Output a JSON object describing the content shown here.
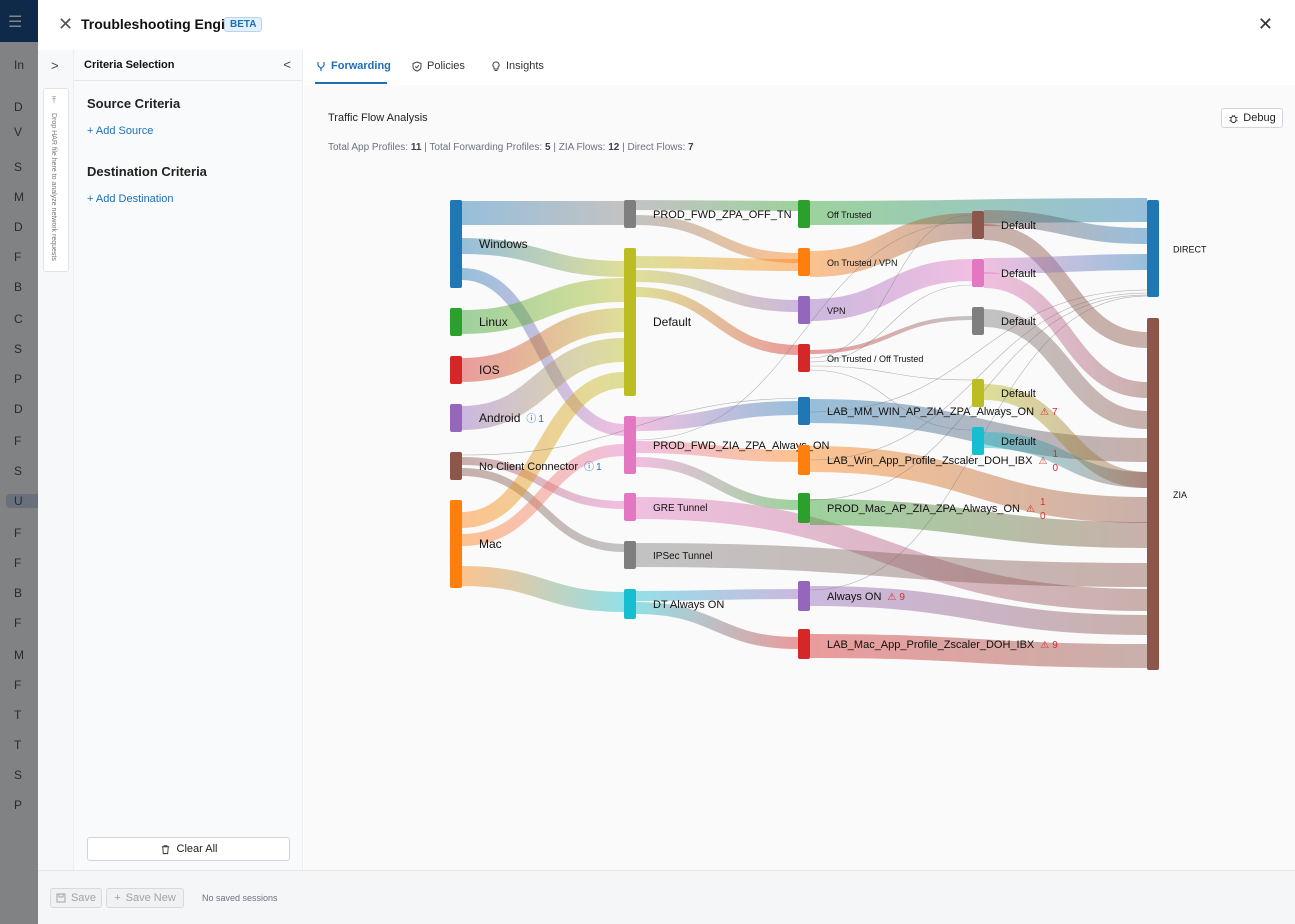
{
  "background": {
    "rail_items": [
      "In",
      "D",
      "V",
      "S",
      "M",
      "D",
      "F",
      "B",
      "C",
      "S",
      "P",
      "D",
      "F",
      "S",
      "U",
      "F",
      "F",
      "B",
      "F",
      "M",
      "F",
      "T",
      "T",
      "S",
      "P"
    ]
  },
  "header": {
    "title": "Troubleshooting Engine",
    "badge": "BETA"
  },
  "sidebar": {
    "drop_hint": "Drop HAR file here to analyze network requests"
  },
  "criteria": {
    "title": "Criteria Selection",
    "source_title": "Source Criteria",
    "add_source": "+ Add Source",
    "destination_title": "Destination Criteria",
    "add_destination": "+ Add Destination",
    "clear_all": "Clear All"
  },
  "tabs": [
    {
      "label": "Forwarding",
      "active": true
    },
    {
      "label": "Policies",
      "active": false
    },
    {
      "label": "Insights",
      "active": false
    }
  ],
  "analysis": {
    "title": "Traffic Flow Analysis",
    "stats": [
      {
        "label": "Total App Profiles: ",
        "value": "11"
      },
      {
        "label": "Total Forwarding Profiles: ",
        "value": "5"
      },
      {
        "label": "ZIA Flows: ",
        "value": "12"
      },
      {
        "label": "Direct Flows: ",
        "value": "7"
      }
    ],
    "debug_label": "Debug"
  },
  "sankey": {
    "nodes": [
      {
        "label": "Windows",
        "color": "#1f77b4",
        "badge": ""
      },
      {
        "label": "Linux",
        "color": "#2ca02c",
        "badge": ""
      },
      {
        "label": "IOS",
        "color": "#d62728",
        "badge": ""
      },
      {
        "label": "Android",
        "color": "#9467bd",
        "badge": "1",
        "badge_type": "info"
      },
      {
        "label": "No Client Connector",
        "color": "#8c564b",
        "badge": "1",
        "badge_type": "info"
      },
      {
        "label": "Mac",
        "color": "#ff7f0e",
        "badge": ""
      },
      {
        "label": "PROD_FWD_ZPA_OFF_TN",
        "color": "#7f7f7f",
        "badge": ""
      },
      {
        "label": "Default",
        "color": "#bcbd22",
        "badge": ""
      },
      {
        "label": "PROD_FWD_ZIA_ZPA_Always_ON",
        "color": "#e377c2",
        "badge": ""
      },
      {
        "label": "GRE Tunnel",
        "color": "#e377c2",
        "badge": ""
      },
      {
        "label": "IPSec Tunnel",
        "color": "#7f7f7f",
        "badge": ""
      },
      {
        "label": "DT Always ON",
        "color": "#17becf",
        "badge": ""
      },
      {
        "label": "Off Trusted",
        "color": "#2ca02c",
        "badge": ""
      },
      {
        "label": "On Trusted / VPN",
        "color": "#ff7f0e",
        "badge": ""
      },
      {
        "label": "VPN",
        "color": "#9467bd",
        "badge": ""
      },
      {
        "label": "On Trusted / Off Trusted",
        "color": "#d62728",
        "badge": ""
      },
      {
        "label": "LAB_MM_WIN_AP_ZIA_ZPA_Always_ON",
        "color": "#1f77b4",
        "badge": "7",
        "badge_type": "warn"
      },
      {
        "label": "LAB_Win_App_Profile_Zscaler_DOH_IBX",
        "color": "#ff7f0e",
        "badge": "10",
        "badge_type": "warn"
      },
      {
        "label": "PROD_Mac_AP_ZIA_ZPA_Always_ON",
        "color": "#2ca02c",
        "badge": "10",
        "badge_type": "warn"
      },
      {
        "label": "Always ON",
        "color": "#9467bd",
        "badge": "9",
        "badge_type": "warn"
      },
      {
        "label": "LAB_Mac_App_Profile_Zscaler_DOH_IBX",
        "color": "#d62728",
        "badge": "9",
        "badge_type": "warn"
      },
      {
        "label": "Default",
        "color": "#8c564b",
        "badge": ""
      },
      {
        "label": "Default",
        "color": "#e377c2",
        "badge": ""
      },
      {
        "label": "Default",
        "color": "#7f7f7f",
        "badge": ""
      },
      {
        "label": "Default",
        "color": "#bcbd22",
        "badge": ""
      },
      {
        "label": "Default",
        "color": "#17becf",
        "badge": ""
      },
      {
        "label": "DIRECT",
        "color": "#1f77b4",
        "badge": ""
      },
      {
        "label": "ZIA",
        "color": "#8c564b",
        "badge": ""
      }
    ],
    "links": [
      {
        "source": "Windows",
        "target": "PROD_FWD_ZPA_OFF_TN"
      },
      {
        "source": "Windows",
        "target": "Default"
      },
      {
        "source": "Windows",
        "target": "PROD_FWD_ZIA_ZPA_Always_ON"
      },
      {
        "source": "Linux",
        "target": "Default"
      },
      {
        "source": "IOS",
        "target": "Default"
      },
      {
        "source": "Android",
        "target": "Default"
      },
      {
        "source": "No Client Connector",
        "target": "GRE Tunnel"
      },
      {
        "source": "No Client Connector",
        "target": "IPSec Tunnel"
      },
      {
        "source": "Mac",
        "target": "Default"
      },
      {
        "source": "Mac",
        "target": "PROD_FWD_ZIA_ZPA_Always_ON"
      },
      {
        "source": "Mac",
        "target": "DT Always ON"
      },
      {
        "source": "PROD_FWD_ZPA_OFF_TN",
        "target": "Off Trusted"
      },
      {
        "source": "PROD_FWD_ZPA_OFF_TN",
        "target": "On Trusted / VPN"
      },
      {
        "source": "Default",
        "target": "On Trusted / VPN"
      },
      {
        "source": "Default",
        "target": "VPN"
      },
      {
        "source": "Default",
        "target": "On Trusted / Off Trusted"
      },
      {
        "source": "PROD_FWD_ZIA_ZPA_Always_ON",
        "target": "LAB_MM_WIN_AP_ZIA_ZPA_Always_ON"
      },
      {
        "source": "PROD_FWD_ZIA_ZPA_Always_ON",
        "target": "LAB_Win_App_Profile_Zscaler_DOH_IBX"
      },
      {
        "source": "PROD_FWD_ZIA_ZPA_Always_ON",
        "target": "PROD_Mac_AP_ZIA_ZPA_Always_ON"
      },
      {
        "source": "GRE Tunnel",
        "target": "ZIA"
      },
      {
        "source": "IPSec Tunnel",
        "target": "ZIA"
      },
      {
        "source": "DT Always ON",
        "target": "Always ON"
      },
      {
        "source": "DT Always ON",
        "target": "LAB_Mac_App_Profile_Zscaler_DOH_IBX"
      },
      {
        "source": "Off Trusted",
        "target": "DIRECT"
      },
      {
        "source": "On Trusted / VPN",
        "target": "Default"
      },
      {
        "source": "VPN",
        "target": "Default"
      },
      {
        "source": "On Trusted / Off Trusted",
        "target": "Default"
      },
      {
        "source": "LAB_MM_WIN_AP_ZIA_ZPA_Always_ON",
        "target": "ZIA"
      },
      {
        "source": "LAB_Win_App_Profile_Zscaler_DOH_IBX",
        "target": "ZIA"
      },
      {
        "source": "PROD_Mac_AP_ZIA_ZPA_Always_ON",
        "target": "ZIA"
      },
      {
        "source": "Always ON",
        "target": "ZIA"
      },
      {
        "source": "LAB_Mac_App_Profile_Zscaler_DOH_IBX",
        "target": "ZIA"
      },
      {
        "source": "Default",
        "target": "DIRECT"
      },
      {
        "source": "Default",
        "target": "ZIA"
      }
    ]
  },
  "footer": {
    "save": "Save",
    "save_new": "Save New",
    "note": "No saved sessions"
  }
}
